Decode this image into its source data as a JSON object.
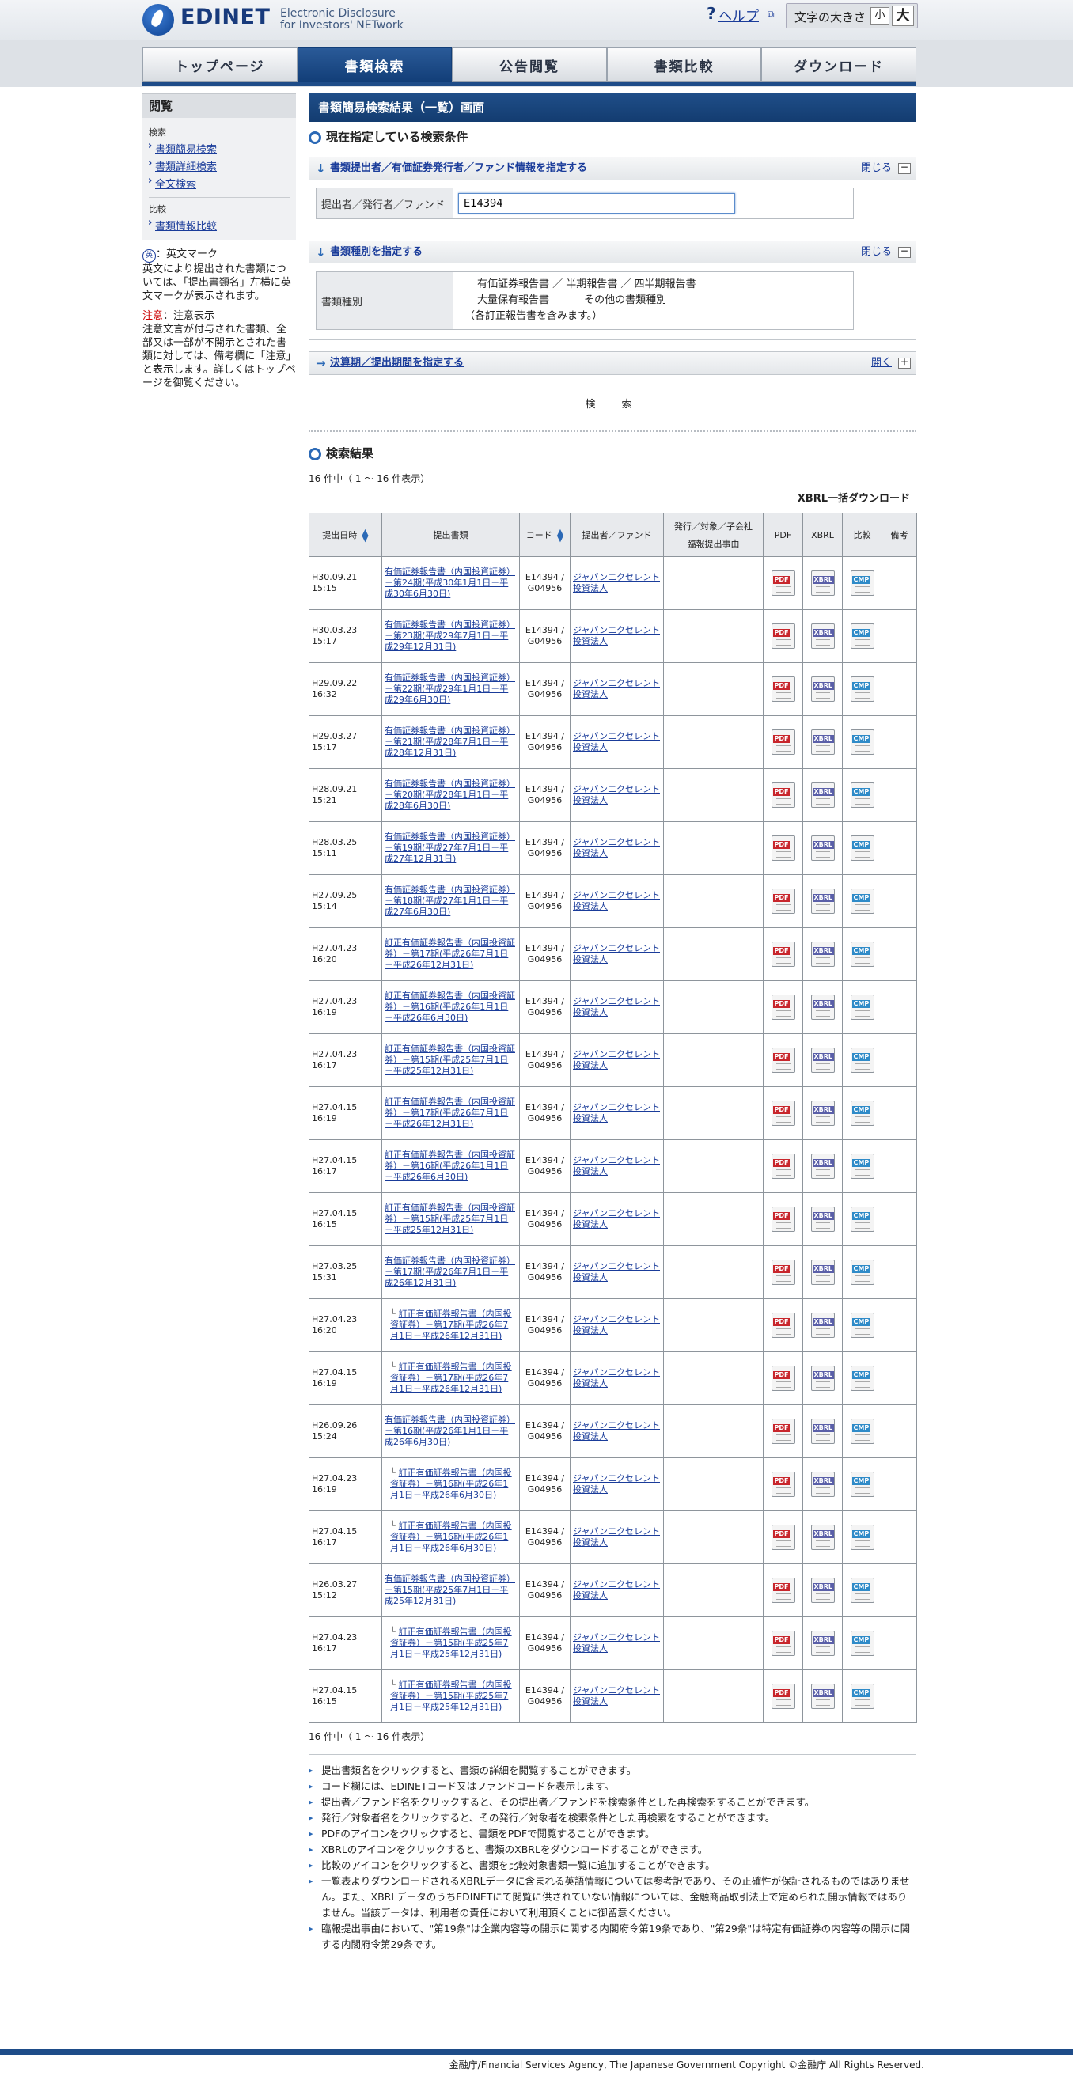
{
  "header": {
    "logo_text": "EDINET",
    "logo_sub1": "Electronic Disclosure",
    "logo_sub2": "for Investors' NETwork",
    "help_icon": "?",
    "help_label": "ヘルプ",
    "fontsize_label": "文字の大きさ",
    "font_small": "小",
    "font_large": "大"
  },
  "nav": [
    "トップページ",
    "書類検索",
    "公告閲覧",
    "書類比較",
    "ダウンロード"
  ],
  "sidebar": {
    "title": "閲覧",
    "group_search": "検索",
    "search_links": [
      "書類簡易検索",
      "書類詳細検索",
      "全文検索"
    ],
    "group_compare": "比較",
    "compare_links": [
      "書類情報比較"
    ],
    "en_icon": "英",
    "en_title": "：英文マーク",
    "en_desc": "英文により提出された書類については、「提出書類名」左横に英文マークが表示されます。",
    "caution_label": "注意",
    "caution_title": "：注意表示",
    "caution_desc": "注意文言が付与された書類、全部又は一部が不開示とされた書類に対しては、備考欄に「注意」と表示します。詳しくはトップページを御覧ください。"
  },
  "main": {
    "title": "書類簡易検索結果（一覧）画面",
    "current_conditions": "現在指定している検索条件",
    "panel1": {
      "title": "書類提出者／有価証券発行者／ファンド情報を指定する",
      "close_label": "閉じる",
      "field_label": "提出者／発行者／ファンド",
      "field_value": "E14394"
    },
    "panel2": {
      "title": "書類種別を指定する",
      "close_label": "閉じる",
      "field_label": "書類種別",
      "line1": "有価証券報告書 ／ 半期報告書 ／ 四半期報告書",
      "line2a": "大量保有報告書",
      "line2b": "その他の書類種別",
      "note": "（各訂正報告書を含みます。）"
    },
    "panel3": {
      "title": "決算期／提出期間を指定する",
      "open_label": "開く"
    },
    "search_button": "検　索",
    "results_title": "検索結果",
    "count_top": "16 件中（ 1 ～ 16 件表示）",
    "count_bottom": "16 件中（ 1 ～ 16 件表示）",
    "xbrl_bulk": "XBRL一括ダウンロード"
  },
  "table": {
    "headers": [
      "提出日時",
      "提出書類",
      "コード",
      "提出者／ファンド",
      "発行／対象／子会社",
      "臨報提出事由",
      "PDF",
      "XBRL",
      "比較",
      "備考"
    ],
    "icons": {
      "pdf": "PDF",
      "xbrl": "XBRL",
      "compare": "CMP"
    },
    "filer": "ジャパンエクセレント投資法人",
    "fund": "ジャパンエクセレント投資法人",
    "rows": [
      {
        "date": "H30.09.21 15:15",
        "doc": "有価証券報告書（内国投資証券）－第24期(平成30年1月1日－平成30年6月30日)",
        "code": "E14394 / G04956",
        "sub": false
      },
      {
        "date": "H30.03.23 15:17",
        "doc": "有価証券報告書（内国投資証券）－第23期(平成29年7月1日－平成29年12月31日)",
        "code": "E14394 / G04956",
        "sub": false
      },
      {
        "date": "H29.09.22 16:32",
        "doc": "有価証券報告書（内国投資証券）－第22期(平成29年1月1日－平成29年6月30日)",
        "code": "E14394 / G04956",
        "sub": false
      },
      {
        "date": "H29.03.27 15:17",
        "doc": "有価証券報告書（内国投資証券）－第21期(平成28年7月1日－平成28年12月31日)",
        "code": "E14394 / G04956",
        "sub": false
      },
      {
        "date": "H28.09.21 15:21",
        "doc": "有価証券報告書（内国投資証券）－第20期(平成28年1月1日－平成28年6月30日)",
        "code": "E14394 / G04956",
        "sub": false
      },
      {
        "date": "H28.03.25 15:11",
        "doc": "有価証券報告書（内国投資証券）－第19期(平成27年7月1日－平成27年12月31日)",
        "code": "E14394 / G04956",
        "sub": false
      },
      {
        "date": "H27.09.25 15:14",
        "doc": "有価証券報告書（内国投資証券）－第18期(平成27年1月1日－平成27年6月30日)",
        "code": "E14394 / G04956",
        "sub": false
      },
      {
        "date": "H27.04.23 16:20",
        "doc": "訂正有価証券報告書（内国投資証券）－第17期(平成26年7月1日－平成26年12月31日)",
        "code": "E14394 / G04956",
        "sub": false
      },
      {
        "date": "H27.04.23 16:19",
        "doc": "訂正有価証券報告書（内国投資証券）－第16期(平成26年1月1日－平成26年6月30日)",
        "code": "E14394 / G04956",
        "sub": false
      },
      {
        "date": "H27.04.23 16:17",
        "doc": "訂正有価証券報告書（内国投資証券）－第15期(平成25年7月1日－平成25年12月31日)",
        "code": "E14394 / G04956",
        "sub": false
      },
      {
        "date": "H27.04.15 16:19",
        "doc": "訂正有価証券報告書（内国投資証券）－第17期(平成26年7月1日－平成26年12月31日)",
        "code": "E14394 / G04956",
        "sub": false
      },
      {
        "date": "H27.04.15 16:17",
        "doc": "訂正有価証券報告書（内国投資証券）－第16期(平成26年1月1日－平成26年6月30日)",
        "code": "E14394 / G04956",
        "sub": false
      },
      {
        "date": "H27.04.15 16:15",
        "doc": "訂正有価証券報告書（内国投資証券）－第15期(平成25年7月1日－平成25年12月31日)",
        "code": "E14394 / G04956",
        "sub": false
      },
      {
        "date": "H27.03.25 15:31",
        "doc": "有価証券報告書（内国投資証券）－第17期(平成26年7月1日－平成26年12月31日)",
        "code": "E14394 / G04956",
        "sub": false
      },
      {
        "date": "H27.04.23 16:20",
        "doc": "訂正有価証券報告書（内国投資証券）－第17期(平成26年7月1日－平成26年12月31日)",
        "code": "E14394 / G04956",
        "sub": true
      },
      {
        "date": "H27.04.15 16:19",
        "doc": "訂正有価証券報告書（内国投資証券）－第17期(平成26年7月1日－平成26年12月31日)",
        "code": "E14394 / G04956",
        "sub": true
      },
      {
        "date": "H26.09.26 15:24",
        "doc": "有価証券報告書（内国投資証券）－第16期(平成26年1月1日－平成26年6月30日)",
        "code": "E14394 / G04956",
        "sub": false
      },
      {
        "date": "H27.04.23 16:19",
        "doc": "訂正有価証券報告書（内国投資証券）－第16期(平成26年1月1日－平成26年6月30日)",
        "code": "E14394 / G04956",
        "sub": true
      },
      {
        "date": "H27.04.15 16:17",
        "doc": "訂正有価証券報告書（内国投資証券）－第16期(平成26年1月1日－平成26年6月30日)",
        "code": "E14394 / G04956",
        "sub": true
      },
      {
        "date": "H26.03.27 15:12",
        "doc": "有価証券報告書（内国投資証券）－第15期(平成25年7月1日－平成25年12月31日)",
        "code": "E14394 / G04956",
        "sub": false
      },
      {
        "date": "H27.04.23 16:17",
        "doc": "訂正有価証券報告書（内国投資証券）－第15期(平成25年7月1日－平成25年12月31日)",
        "code": "E14394 / G04956",
        "sub": true
      },
      {
        "date": "H27.04.15 16:15",
        "doc": "訂正有価証券報告書（内国投資証券）－第15期(平成25年7月1日－平成25年12月31日)",
        "code": "E14394 / G04956",
        "sub": true
      }
    ]
  },
  "notes": [
    "提出書類名をクリックすると、書類の詳細を閲覧することができます。",
    "コード欄には、EDINETコード又はファンドコードを表示します。",
    "提出者／ファンド名をクリックすると、その提出者／ファンドを検索条件とした再検索をすることができます。",
    "発行／対象者名をクリックすると、その発行／対象者を検索条件とした再検索をすることができます。",
    "PDFのアイコンをクリックすると、書類をPDFで閲覧することができます。",
    "XBRLのアイコンをクリックすると、書類のXBRLをダウンロードすることができます。",
    "比較のアイコンをクリックすると、書類を比較対象書類一覧に追加することができます。",
    "一覧表よりダウンロードされるXBRLデータに含まれる英語情報については参考訳であり、その正確性が保証されるものではありません。また、XBRLデータのうちEDINETにて閲覧に供されていない情報については、金融商品取引法上で定められた開示情報ではありません。当該データは、利用者の責任において利用頂くことに御留意ください。",
    "臨報提出事由において、\"第19条\"は企業内容等の開示に関する内閣府令第19条であり、\"第29条\"は特定有価証券の内容等の開示に関する内閣府令第29条です。"
  ],
  "footer": "金融庁/Financial Services Agency, The Japanese Government Copyright ©金融庁 All Rights Reserved."
}
